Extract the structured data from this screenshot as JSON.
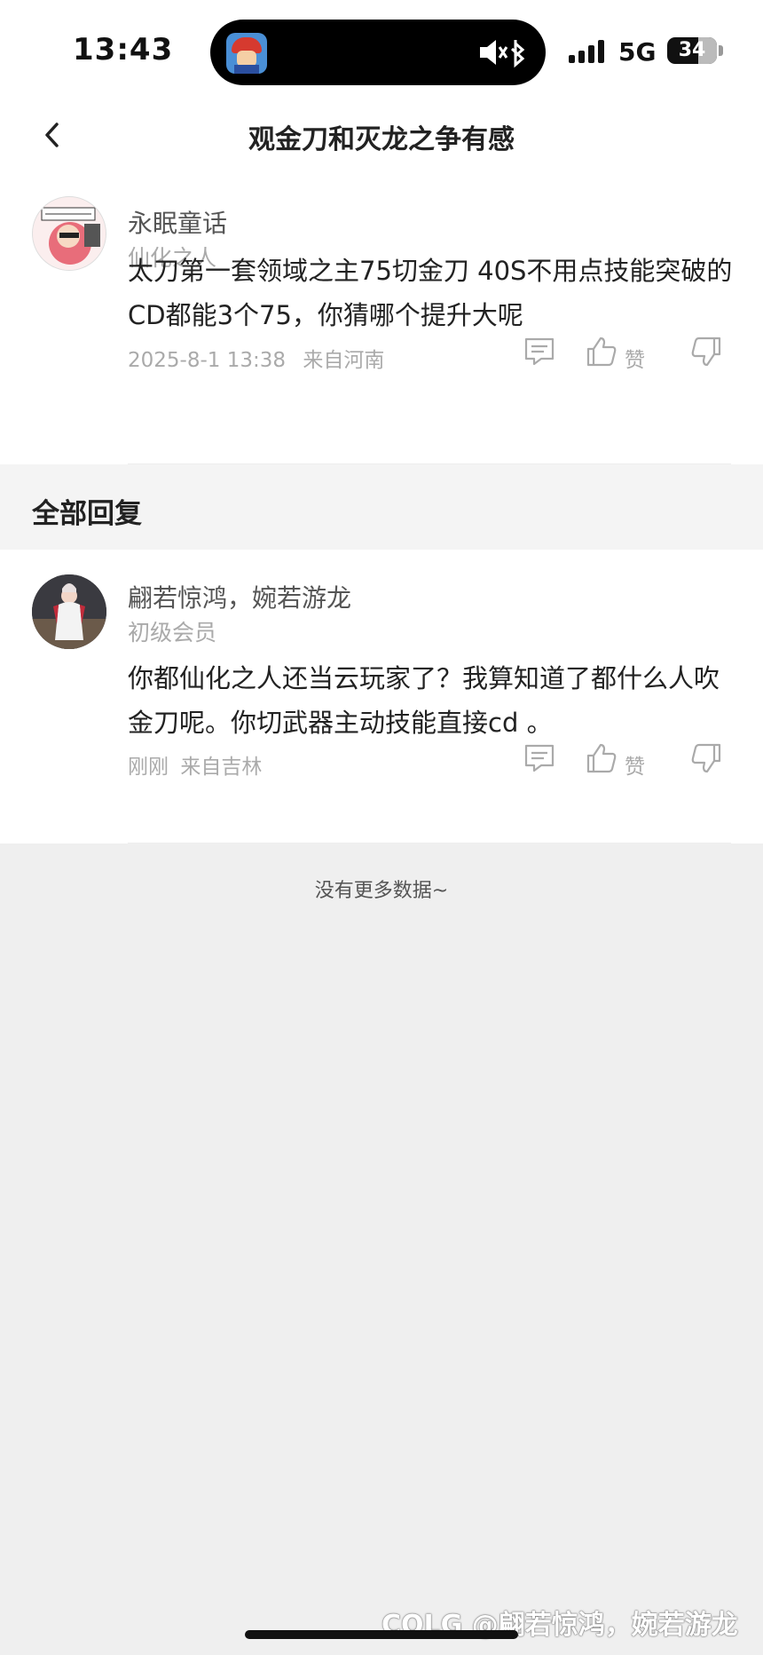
{
  "status_bar": {
    "time": "13:43",
    "network": "5G",
    "battery": "34"
  },
  "header": {
    "title": "观金刀和灭龙之争有感"
  },
  "post": {
    "username": "永眠童话",
    "level": "仙化之人",
    "content": "太刀第一套领域之主75切金刀 40S不用点技能突破的CD都能3个75，你猜哪个提升大呢",
    "timestamp": "2025-8-1 13:38",
    "location": "来自河南",
    "like_label": "赞"
  },
  "replies_section": {
    "title": "全部回复"
  },
  "replies": [
    {
      "username": "翩若惊鸿，婉若游龙",
      "level": "初级会员",
      "content": "你都仙化之人还当云玩家了？我算知道了都什么人吹金刀呢。你切武器主动技能直接cd 。",
      "timestamp": "刚刚",
      "location": "来自吉林",
      "like_label": "赞"
    }
  ],
  "footer": {
    "no_more": "没有更多数据~"
  },
  "watermark": "COLG @翩若惊鸿，婉若游龙",
  "icons": {
    "back": "chevron-left-icon",
    "comment": "comment-icon",
    "like": "thumbs-up-icon",
    "dislike": "thumbs-down-icon",
    "mute": "speaker-mute-icon",
    "bluetooth": "bluetooth-icon"
  }
}
